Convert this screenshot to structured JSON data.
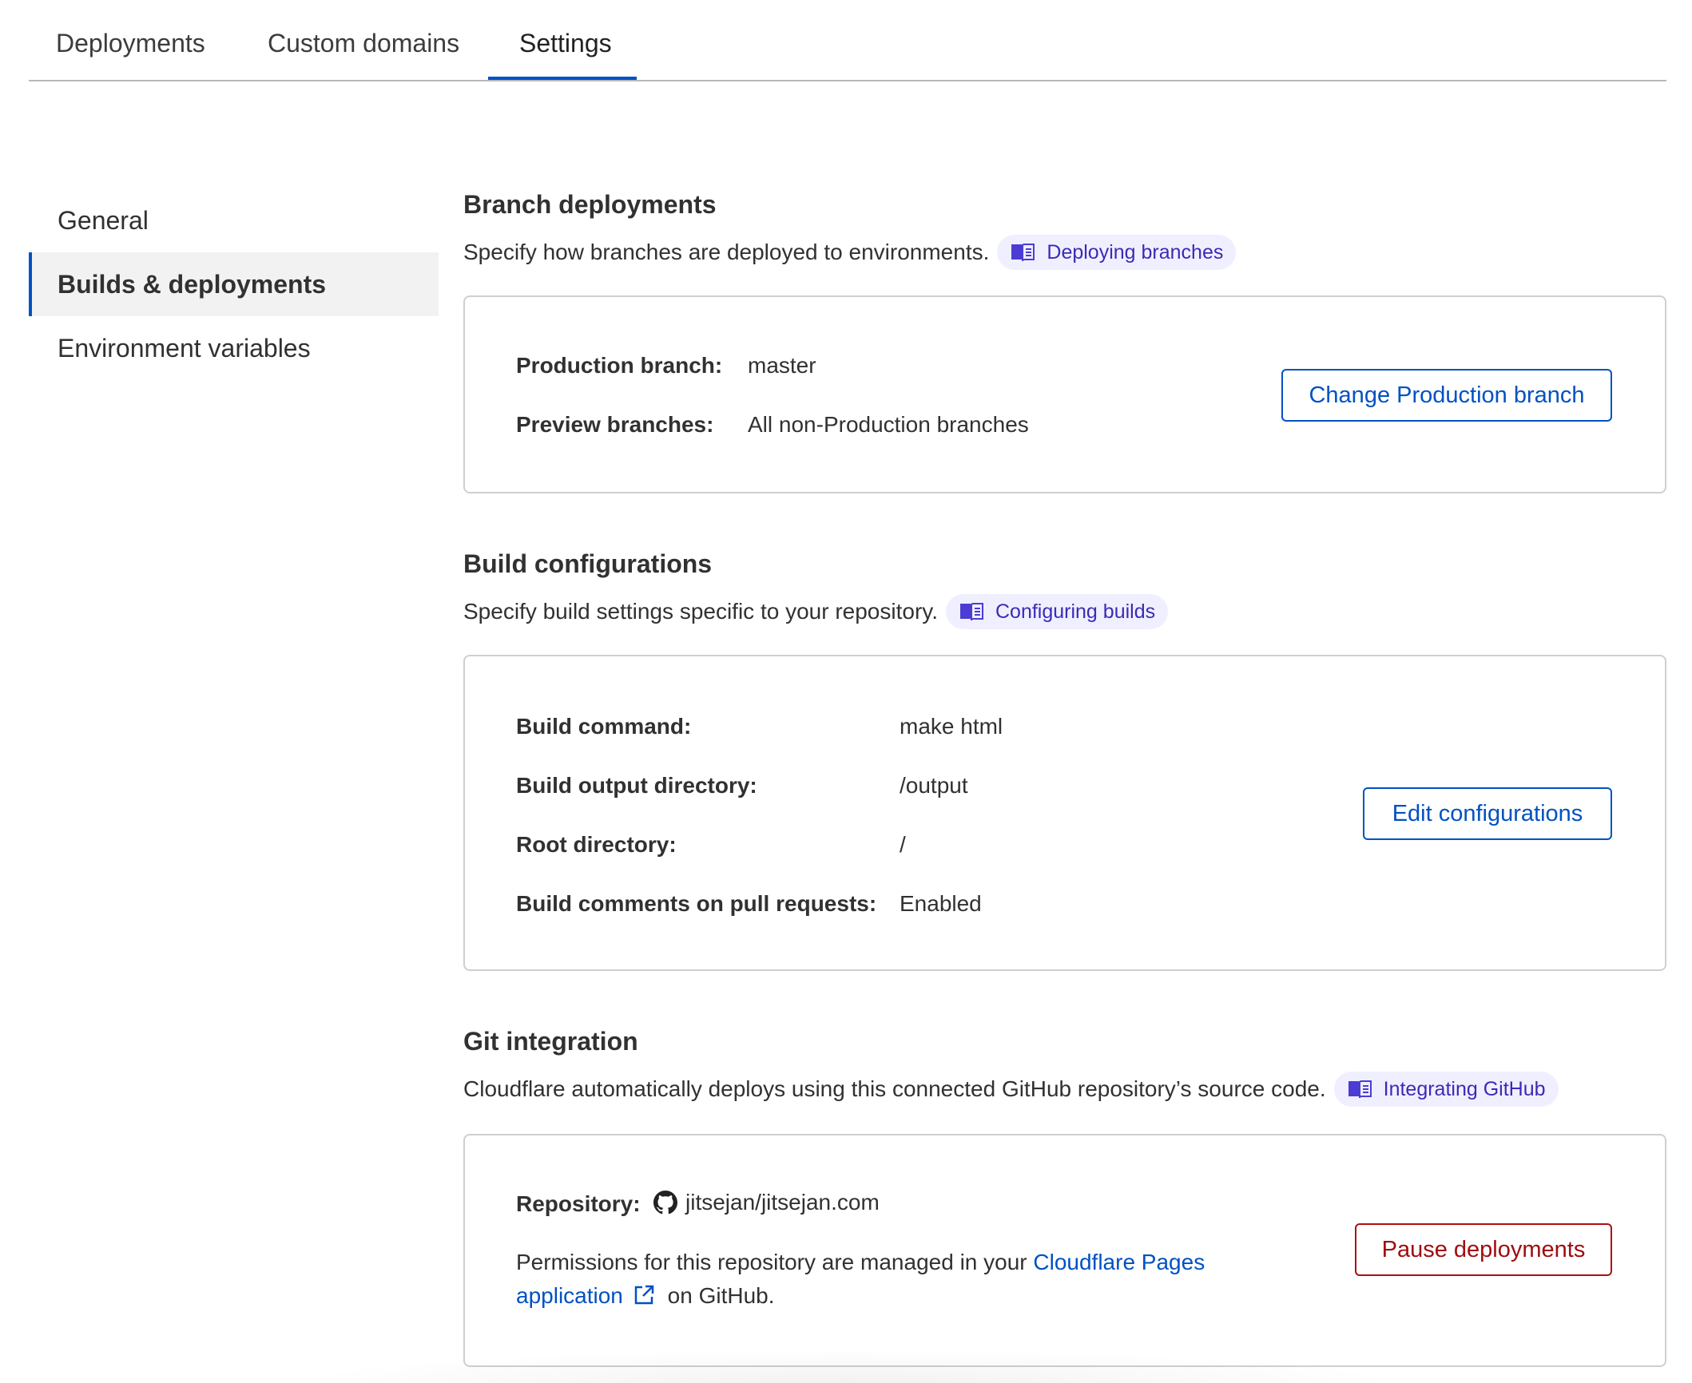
{
  "tabs": [
    {
      "label": "Deployments"
    },
    {
      "label": "Custom domains"
    },
    {
      "label": "Settings",
      "active": true
    }
  ],
  "sidebar": {
    "items": [
      {
        "label": "General"
      },
      {
        "label": "Builds & deployments",
        "active": true
      },
      {
        "label": "Environment variables"
      }
    ]
  },
  "branch_deployments": {
    "title": "Branch deployments",
    "description": "Specify how branches are deployed to environments.",
    "doc_link": "Deploying branches",
    "production_label": "Production branch:",
    "production_value": "master",
    "preview_label": "Preview branches:",
    "preview_value": "All non-Production branches",
    "button": "Change Production branch"
  },
  "build_configurations": {
    "title": "Build configurations",
    "description": "Specify build settings specific to your repository.",
    "doc_link": "Configuring builds",
    "rows": [
      {
        "label": "Build command:",
        "value": "make html"
      },
      {
        "label": "Build output directory:",
        "value": "/output"
      },
      {
        "label": "Root directory:",
        "value": "/"
      },
      {
        "label": "Build comments on pull requests:",
        "value": "Enabled"
      }
    ],
    "button": "Edit configurations"
  },
  "git_integration": {
    "title": "Git integration",
    "description": "Cloudflare automatically deploys using this connected GitHub repository’s source code.",
    "doc_link": "Integrating GitHub",
    "repository_label": "Repository:",
    "repository_value": "jitsejan/jitsejan.com",
    "permissions_prefix": "Permissions for this repository are managed in your ",
    "permissions_link": "Cloudflare Pages application",
    "permissions_suffix": " on GitHub.",
    "button": "Pause deployments"
  },
  "colors": {
    "accent": "#0051c3",
    "danger": "#b00d12",
    "doc_pill_bg": "#f0efff",
    "doc_pill_text": "#3a2bb5"
  },
  "icons": {
    "doc": "book-icon",
    "repo": "github-icon",
    "external": "external-link-icon"
  }
}
